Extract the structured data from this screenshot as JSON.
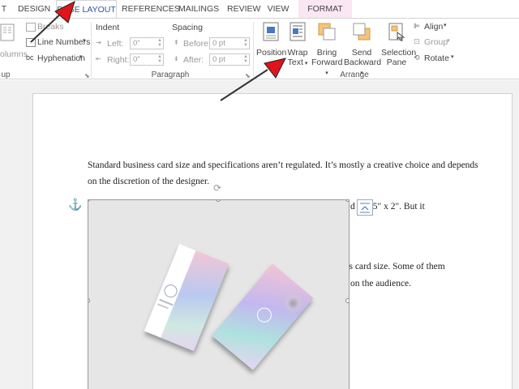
{
  "tabs": {
    "t0": "T",
    "design": "DESIGN",
    "page_layout": "PAGE LAYOUT",
    "references": "REFERENCES",
    "mailings": "MAILINGS",
    "review": "REVIEW",
    "view": "VIEW",
    "format": "FORMAT"
  },
  "ribbon": {
    "page_setup": {
      "columns_label": "olumns",
      "breaks_label": "Breaks",
      "line_numbers_label": "Line Numbers",
      "hyphenation_label": "Hyphenation",
      "group_label": "up"
    },
    "paragraph": {
      "indent_heading": "Indent",
      "spacing_heading": "Spacing",
      "left_label": "Left:",
      "right_label": "Right:",
      "before_label": "Before:",
      "after_label": "After:",
      "left_value": "0\"",
      "right_value": "0\"",
      "before_value": "0 pt",
      "after_value": "0 pt",
      "group_label": "Paragraph"
    },
    "arrange": {
      "position_label": "Position",
      "wrap_text_line1": "Wrap",
      "wrap_text_line2": "Text",
      "bring_forward_line1": "Bring",
      "bring_forward_line2": "Forward",
      "send_backward_line1": "Send",
      "send_backward_line2": "Backward",
      "selection_pane_line1": "Selection",
      "selection_pane_line2": "Pane",
      "align_label": "Align",
      "group_label_btn": "Group",
      "rotate_label": "Rotate",
      "group_label": "Arrange"
    }
  },
  "document": {
    "para1_line1": "Standard business card size and specifications aren’t regulated. It’s mostly a creative choice and depends",
    "para1_line2": "on the discretion of the designer.",
    "para2_line1_right": "d  is 3.5\" x 2\". But it",
    "para3_line1_right": "ss card size. Some of them",
    "para3_line2_right": "on the audience."
  },
  "colors": {
    "active_tab_text": "#2b579a",
    "format_tab_bg": "#fbe6f3",
    "arrow_red": "#e0141b",
    "anchor_blue": "#3a6fb8"
  }
}
